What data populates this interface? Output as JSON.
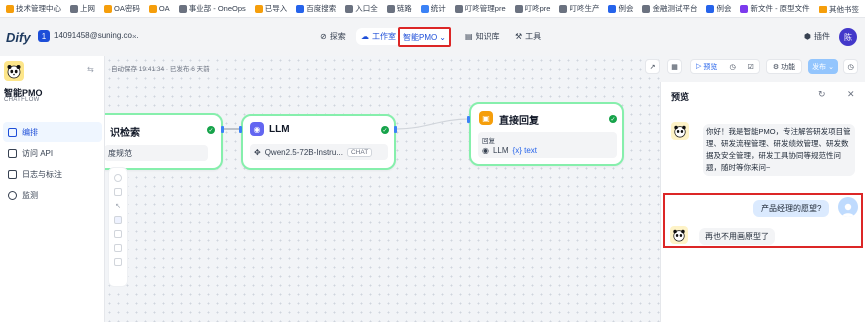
{
  "bookmarks": [
    {
      "label": "技术管理中心",
      "color": "#f59e0b"
    },
    {
      "label": "上网",
      "color": "#6b7280"
    },
    {
      "label": "OA密码",
      "color": "#f59e0b"
    },
    {
      "label": "OA",
      "color": "#f59e0b"
    },
    {
      "label": "事业部 - OneOps",
      "color": "#6b7280"
    },
    {
      "label": "已导入",
      "color": "#f59e0b"
    },
    {
      "label": "百度搜索",
      "color": "#2563eb"
    },
    {
      "label": "入口全",
      "color": "#6b7280"
    },
    {
      "label": "链路",
      "color": "#6b7280"
    },
    {
      "label": "统计",
      "color": "#3b82f6"
    },
    {
      "label": "叮咚管理pre",
      "color": "#6b7280"
    },
    {
      "label": "叮咚pre",
      "color": "#6b7280"
    },
    {
      "label": "叮咚生产",
      "color": "#6b7280"
    },
    {
      "label": "例会",
      "color": "#2563eb"
    },
    {
      "label": "金融测试平台",
      "color": "#6b7280"
    },
    {
      "label": "例会",
      "color": "#2563eb"
    },
    {
      "label": "新文件 - 原型文件",
      "color": "#7c3aed"
    }
  ],
  "bookmarks_other": "其他书签",
  "header": {
    "logo": "Dify",
    "workspace_badge": "1",
    "workspace_name": "14091458@suning.co...",
    "nav_explore": "探索",
    "nav_studio": "工作室",
    "app_switch": "智能PMO",
    "nav_knowledge": "知识库",
    "nav_tools": "工具",
    "plugins": "插件",
    "user_avatar": "陈"
  },
  "sidebar": {
    "app_title": "智能PMO",
    "app_mode": "CHATFLOW",
    "items": [
      {
        "label": "编排",
        "active": true
      },
      {
        "label": "访问 API",
        "active": false
      },
      {
        "label": "日志与标注",
        "active": false
      },
      {
        "label": "监测",
        "active": false
      }
    ]
  },
  "canvas": {
    "autosave": "自动保存 19:41:34 · 已发布 6 天前",
    "toolbar": {
      "preview": "预览",
      "features": "功能",
      "publish": "发布"
    },
    "nodes": {
      "knowledge": {
        "title": "识检索",
        "row": "度规范"
      },
      "llm": {
        "title": "LLM",
        "model": "Qwen2.5-72B-Instru...",
        "tag": "CHAT"
      },
      "answer": {
        "title": "直接回复",
        "label": "回复",
        "var_node": "LLM",
        "var_name": "{x} text"
      }
    }
  },
  "preview": {
    "title": "预览",
    "bot_greeting": "你好！我是智能PMO，专注解答研发项目管理、研发流程管理、研发绩效管理、研发数据及安全管理，研发工具协同等规范性问题，随时等你来问~",
    "user_message": "产品经理的愿望?",
    "bot_reply": "再也不用画原型了"
  }
}
